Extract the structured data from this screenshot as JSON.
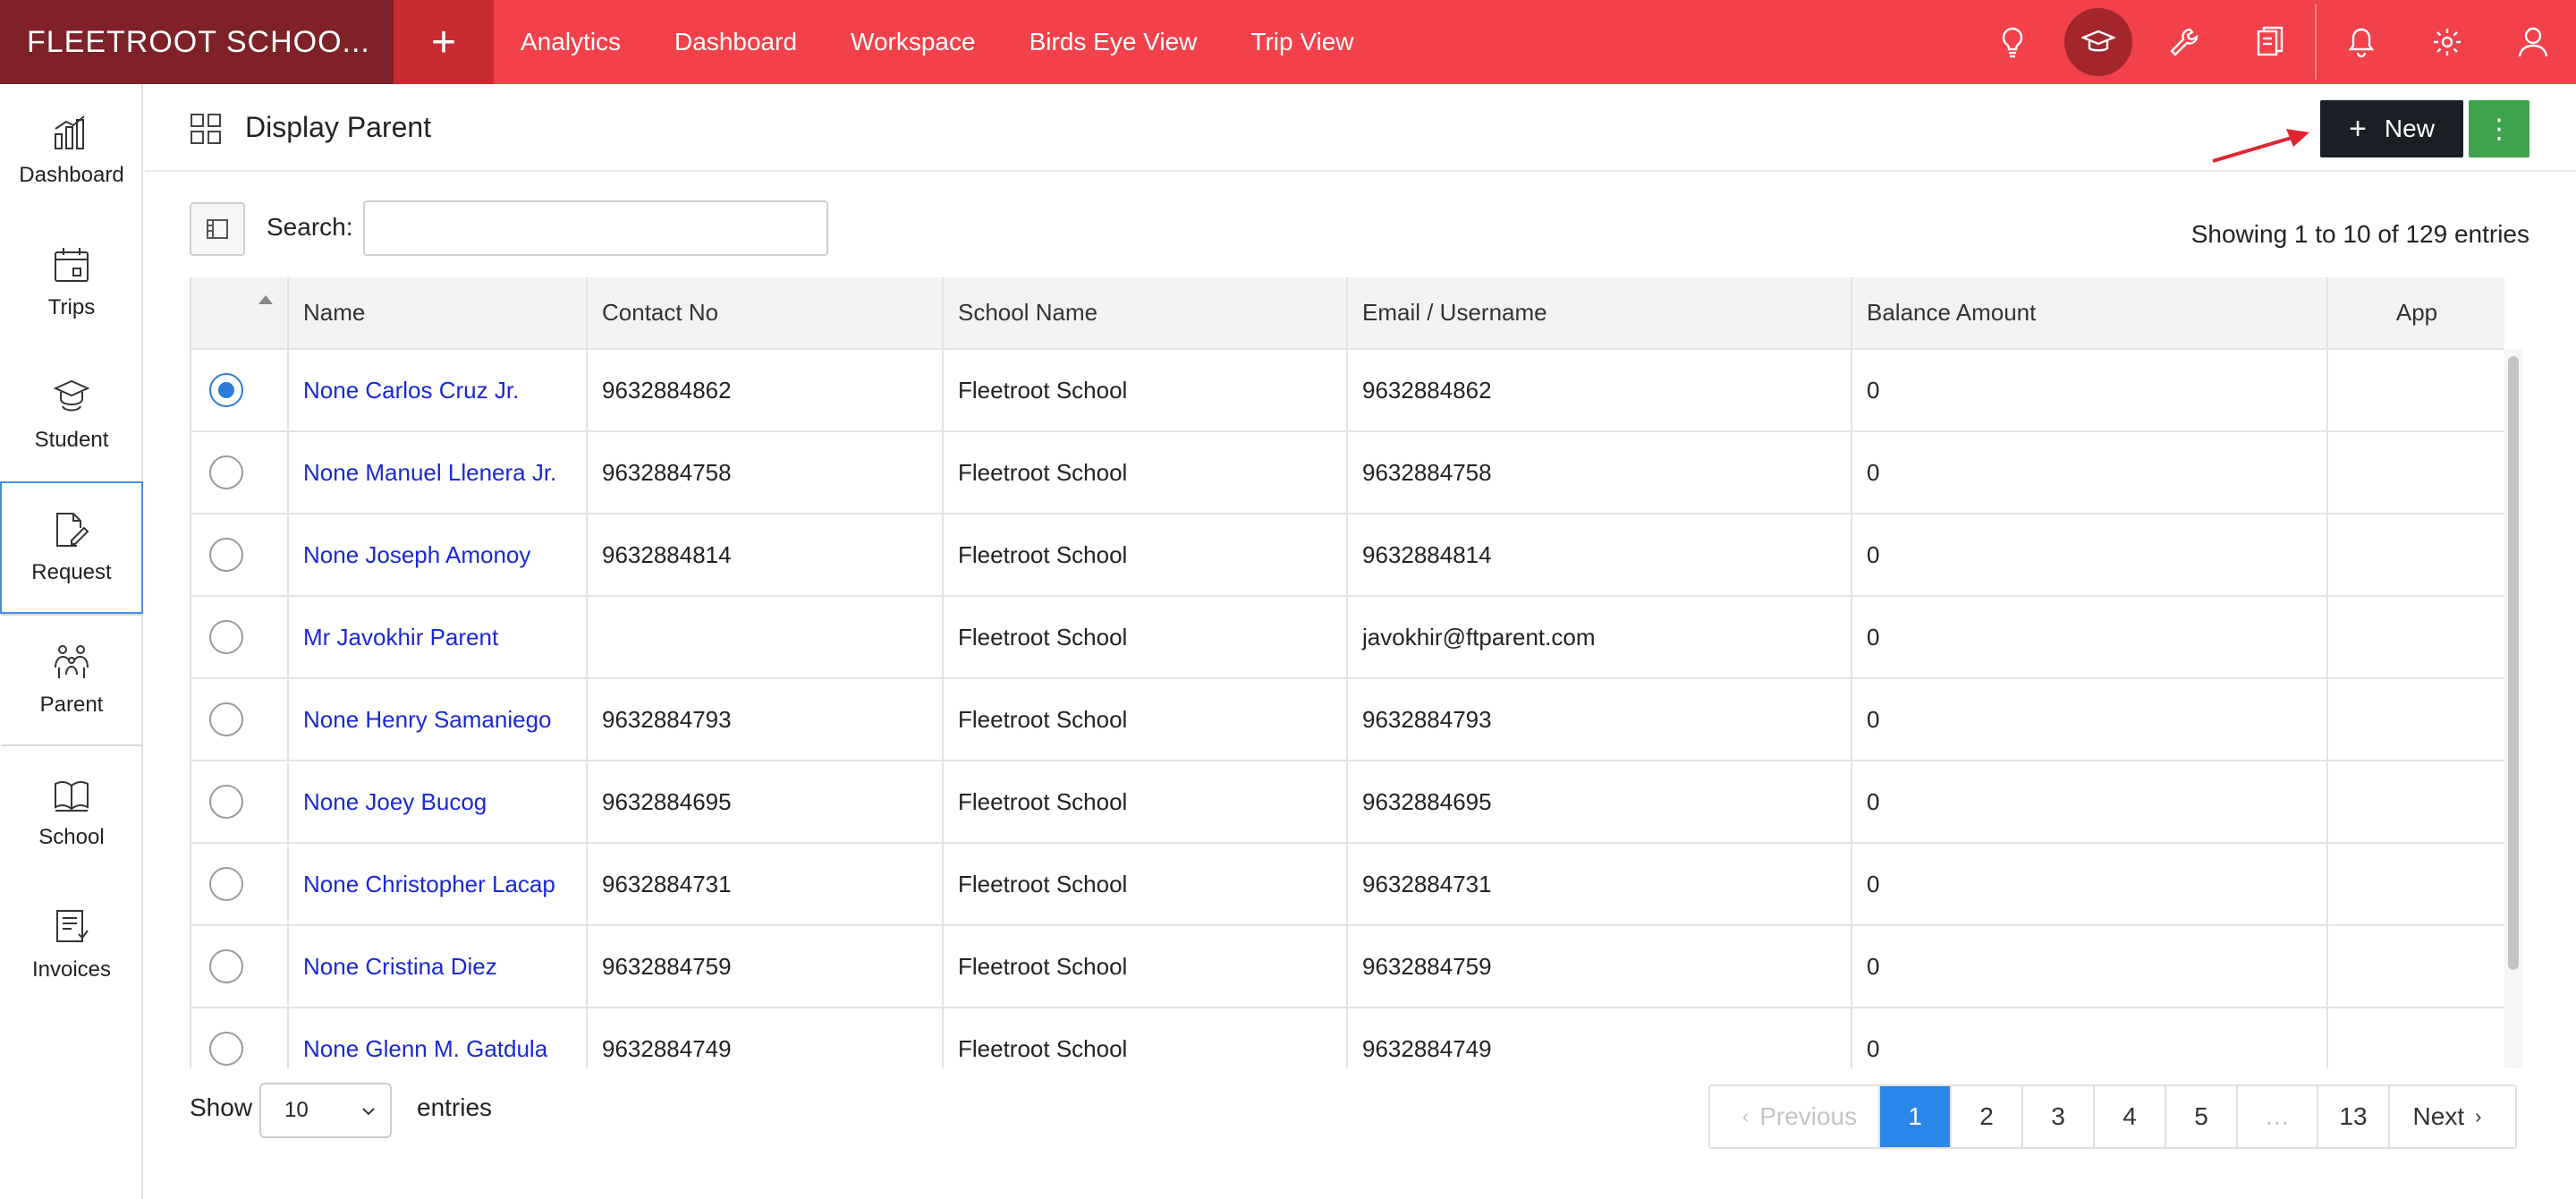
{
  "app": {
    "brand": "FLEETROOT SCHOO...",
    "accent_color": "#f2414a"
  },
  "nav": [
    {
      "label": "Analytics"
    },
    {
      "label": "Dashboard"
    },
    {
      "label": "Workspace"
    },
    {
      "label": "Birds Eye View"
    },
    {
      "label": "Trip View"
    }
  ],
  "top_icons": [
    "lightbulb-icon",
    "graduation-cap-icon",
    "wrench-icon",
    "clipboard-icon",
    "bell-icon",
    "gear-icon",
    "user-icon"
  ],
  "sidebar": [
    {
      "label": "Dashboard",
      "icon": "bar-chart-icon"
    },
    {
      "label": "Trips",
      "icon": "calendar-icon"
    },
    {
      "label": "Student",
      "icon": "student-icon"
    },
    {
      "label": "Request",
      "icon": "edit-document-icon"
    },
    {
      "label": "Parent",
      "icon": "family-icon"
    },
    {
      "label": "School",
      "icon": "school-icon"
    },
    {
      "label": "Invoices",
      "icon": "invoice-icon"
    }
  ],
  "page": {
    "title": "Display Parent",
    "new_label": "New",
    "more_label": "⋮"
  },
  "search": {
    "label": "Search:",
    "value": "",
    "placeholder": ""
  },
  "showing_text": "Showing 1 to 10 of 129 entries",
  "table": {
    "columns": [
      "Name",
      "Contact No",
      "School Name",
      "Email / Username",
      "Balance Amount",
      "App"
    ],
    "rows": [
      {
        "name": "None Carlos Cruz Jr.",
        "contact": "9632884862",
        "school": "Fleetroot School",
        "email": "9632884862",
        "balance": "0",
        "selected": true
      },
      {
        "name": "None Manuel Llenera Jr.",
        "contact": "9632884758",
        "school": "Fleetroot School",
        "email": "9632884758",
        "balance": "0",
        "selected": false
      },
      {
        "name": "None Joseph Amonoy",
        "contact": "9632884814",
        "school": "Fleetroot School",
        "email": "9632884814",
        "balance": "0",
        "selected": false
      },
      {
        "name": "Mr Javokhir Parent",
        "contact": "",
        "school": "Fleetroot School",
        "email": "javokhir@ftparent.com",
        "balance": "0",
        "selected": false
      },
      {
        "name": "None Henry Samaniego",
        "contact": "9632884793",
        "school": "Fleetroot School",
        "email": "9632884793",
        "balance": "0",
        "selected": false
      },
      {
        "name": "None Joey Bucog",
        "contact": "9632884695",
        "school": "Fleetroot School",
        "email": "9632884695",
        "balance": "0",
        "selected": false
      },
      {
        "name": "None Christopher Lacap",
        "contact": "9632884731",
        "school": "Fleetroot School",
        "email": "9632884731",
        "balance": "0",
        "selected": false
      },
      {
        "name": "None Cristina Diez",
        "contact": "9632884759",
        "school": "Fleetroot School",
        "email": "9632884759",
        "balance": "0",
        "selected": false
      },
      {
        "name": "None Glenn M. Gatdula",
        "contact": "9632884749",
        "school": "Fleetroot School",
        "email": "9632884749",
        "balance": "0",
        "selected": false
      }
    ]
  },
  "footer": {
    "show_label": "Show",
    "page_size": "10",
    "entries_label": "entries",
    "prev_label": "Previous",
    "next_label": "Next",
    "pages": [
      "1",
      "2",
      "3",
      "4",
      "5",
      "…",
      "13"
    ],
    "current_page": "1"
  }
}
